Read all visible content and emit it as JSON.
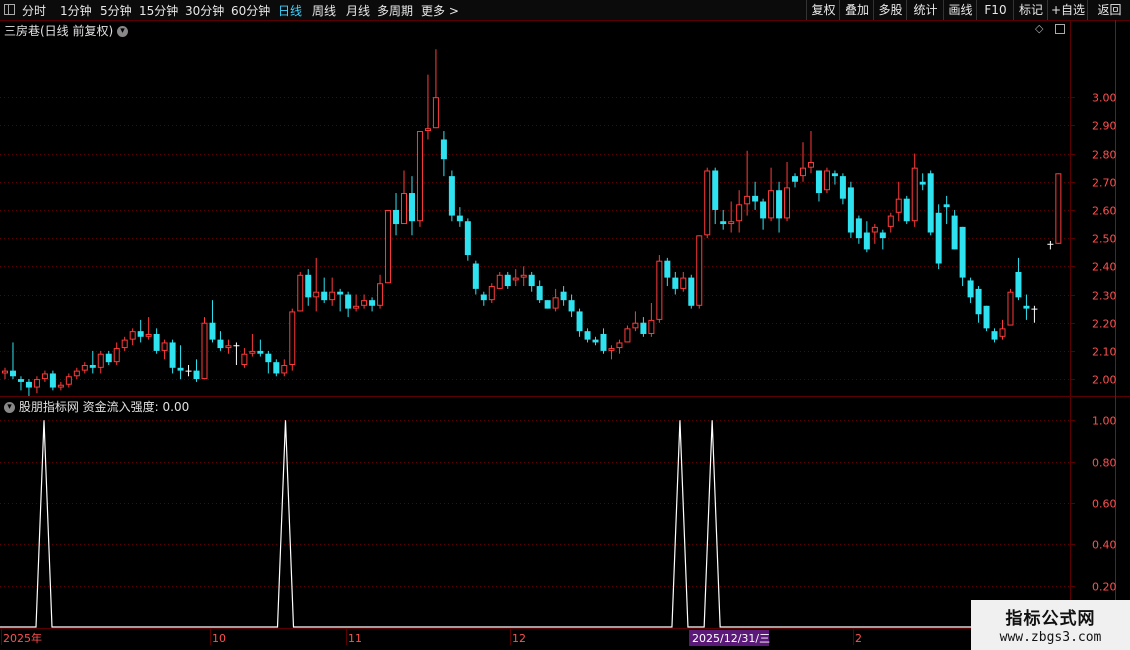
{
  "toolbar": {
    "periods": [
      "分时",
      "1分钟",
      "5分钟",
      "15分钟",
      "30分钟",
      "60分钟",
      "日线",
      "周线",
      "月线",
      "多周期",
      "更多 >"
    ],
    "active_period": "日线",
    "actions": [
      "复权",
      "叠加",
      "多股",
      "统计",
      "画线",
      "F10",
      "标记",
      "+自选",
      "返回"
    ]
  },
  "main_panel": {
    "title": "三房巷(日线 前复权)",
    "y_ticks": [
      "3.00",
      "2.90",
      "2.80",
      "2.70",
      "2.60",
      "2.50",
      "2.40",
      "2.30",
      "2.20",
      "2.10",
      "2.00"
    ]
  },
  "indicator_panel": {
    "title": "股朋指标网 资金流入强度: 0.00",
    "y_ticks": [
      "1.00",
      "0.80",
      "0.60",
      "0.40",
      "0.20"
    ]
  },
  "x_axis": {
    "labels": [
      "2025年",
      "10",
      "11",
      "12",
      "2025/12/31/三",
      "2"
    ]
  },
  "watermark": {
    "line1": "指标公式网",
    "line2": "www.zbgs3.com"
  },
  "colors": {
    "up": "#ff3b3b",
    "down": "#2fe2f0",
    "doji": "#ffffff",
    "grid": "#5a0000",
    "signal": "#ffffff"
  },
  "chart_data": [
    {
      "type": "candlestick",
      "title": "三房巷(日线 前复权)",
      "ylim": [
        1.94,
        3.21
      ],
      "grid": true,
      "candles": [
        [
          2.02,
          2.03,
          2.04,
          2.0
        ],
        [
          2.03,
          2.01,
          2.13,
          2.0
        ],
        [
          2.0,
          1.99,
          2.01,
          1.96
        ],
        [
          1.99,
          1.97,
          2.0,
          1.94
        ],
        [
          1.97,
          2.0,
          2.01,
          1.95
        ],
        [
          2.0,
          2.02,
          2.03,
          1.99
        ],
        [
          2.02,
          1.97,
          2.03,
          1.96
        ],
        [
          1.97,
          1.98,
          1.99,
          1.96
        ],
        [
          1.98,
          2.01,
          2.02,
          1.97
        ],
        [
          2.01,
          2.03,
          2.04,
          2.0
        ],
        [
          2.03,
          2.05,
          2.06,
          2.02
        ],
        [
          2.05,
          2.04,
          2.1,
          2.02
        ],
        [
          2.04,
          2.09,
          2.1,
          2.02
        ],
        [
          2.09,
          2.06,
          2.1,
          2.05
        ],
        [
          2.06,
          2.11,
          2.13,
          2.05
        ],
        [
          2.11,
          2.14,
          2.15,
          2.1
        ],
        [
          2.14,
          2.17,
          2.18,
          2.12
        ],
        [
          2.17,
          2.15,
          2.21,
          2.13
        ],
        [
          2.15,
          2.16,
          2.22,
          2.14
        ],
        [
          2.16,
          2.1,
          2.18,
          2.09
        ],
        [
          2.1,
          2.13,
          2.14,
          2.07
        ],
        [
          2.13,
          2.04,
          2.14,
          2.02
        ],
        [
          2.04,
          2.03,
          2.12,
          2.0
        ],
        [
          2.03,
          2.03,
          2.05,
          2.01
        ],
        [
          2.03,
          2.0,
          2.07,
          1.99
        ],
        [
          2.0,
          2.2,
          2.22,
          2.0
        ],
        [
          2.2,
          2.14,
          2.28,
          2.13
        ],
        [
          2.14,
          2.11,
          2.17,
          2.1
        ],
        [
          2.11,
          2.12,
          2.14,
          2.09
        ],
        [
          2.12,
          2.12,
          2.13,
          2.05
        ],
        [
          2.05,
          2.09,
          2.11,
          2.04
        ],
        [
          2.09,
          2.1,
          2.16,
          2.08
        ],
        [
          2.1,
          2.09,
          2.14,
          2.08
        ],
        [
          2.09,
          2.06,
          2.1,
          2.02
        ],
        [
          2.06,
          2.02,
          2.07,
          2.01
        ],
        [
          2.02,
          2.05,
          2.07,
          2.01
        ],
        [
          2.05,
          2.24,
          2.25,
          2.03
        ],
        [
          2.24,
          2.37,
          2.38,
          2.24
        ],
        [
          2.37,
          2.29,
          2.39,
          2.26
        ],
        [
          2.29,
          2.31,
          2.43,
          2.24
        ],
        [
          2.31,
          2.28,
          2.36,
          2.27
        ],
        [
          2.28,
          2.31,
          2.36,
          2.26
        ],
        [
          2.31,
          2.3,
          2.32,
          2.24
        ],
        [
          2.3,
          2.25,
          2.31,
          2.22
        ],
        [
          2.25,
          2.26,
          2.3,
          2.24
        ],
        [
          2.26,
          2.28,
          2.3,
          2.25
        ],
        [
          2.28,
          2.26,
          2.29,
          2.24
        ],
        [
          2.26,
          2.34,
          2.37,
          2.25
        ],
        [
          2.34,
          2.6,
          2.6,
          2.34
        ],
        [
          2.6,
          2.55,
          2.66,
          2.51
        ],
        [
          2.55,
          2.66,
          2.74,
          2.55
        ],
        [
          2.66,
          2.56,
          2.72,
          2.51
        ],
        [
          2.56,
          2.88,
          2.88,
          2.54
        ],
        [
          2.88,
          2.89,
          3.08,
          2.85
        ],
        [
          2.89,
          3.0,
          3.17,
          2.89
        ],
        [
          2.85,
          2.78,
          2.88,
          2.72
        ],
        [
          2.72,
          2.58,
          2.74,
          2.56
        ],
        [
          2.58,
          2.56,
          2.61,
          2.54
        ],
        [
          2.56,
          2.44,
          2.57,
          2.42
        ],
        [
          2.41,
          2.32,
          2.42,
          2.3
        ],
        [
          2.3,
          2.28,
          2.31,
          2.26
        ],
        [
          2.28,
          2.33,
          2.34,
          2.27
        ],
        [
          2.32,
          2.37,
          2.38,
          2.32
        ],
        [
          2.37,
          2.33,
          2.38,
          2.32
        ],
        [
          2.35,
          2.36,
          2.39,
          2.33
        ],
        [
          2.36,
          2.37,
          2.4,
          2.33
        ],
        [
          2.37,
          2.33,
          2.38,
          2.31
        ],
        [
          2.33,
          2.28,
          2.35,
          2.27
        ],
        [
          2.28,
          2.25,
          2.28,
          2.25
        ],
        [
          2.25,
          2.29,
          2.32,
          2.24
        ],
        [
          2.31,
          2.28,
          2.33,
          2.26
        ],
        [
          2.28,
          2.24,
          2.3,
          2.22
        ],
        [
          2.24,
          2.17,
          2.25,
          2.15
        ],
        [
          2.17,
          2.14,
          2.18,
          2.13
        ],
        [
          2.14,
          2.13,
          2.15,
          2.12
        ],
        [
          2.16,
          2.1,
          2.18,
          2.09
        ],
        [
          2.1,
          2.11,
          2.12,
          2.07
        ],
        [
          2.11,
          2.13,
          2.14,
          2.09
        ],
        [
          2.13,
          2.18,
          2.19,
          2.13
        ],
        [
          2.18,
          2.2,
          2.24,
          2.17
        ],
        [
          2.2,
          2.16,
          2.22,
          2.15
        ],
        [
          2.16,
          2.21,
          2.27,
          2.15
        ],
        [
          2.21,
          2.42,
          2.44,
          2.2
        ],
        [
          2.42,
          2.36,
          2.43,
          2.33
        ],
        [
          2.36,
          2.32,
          2.38,
          2.3
        ],
        [
          2.32,
          2.36,
          2.38,
          2.31
        ],
        [
          2.36,
          2.26,
          2.37,
          2.25
        ],
        [
          2.26,
          2.51,
          2.51,
          2.25
        ],
        [
          2.51,
          2.74,
          2.75,
          2.5
        ],
        [
          2.74,
          2.6,
          2.75,
          2.55
        ],
        [
          2.56,
          2.55,
          2.6,
          2.53
        ],
        [
          2.55,
          2.56,
          2.63,
          2.52
        ],
        [
          2.56,
          2.62,
          2.67,
          2.52
        ],
        [
          2.62,
          2.65,
          2.81,
          2.58
        ],
        [
          2.65,
          2.63,
          2.7,
          2.6
        ],
        [
          2.63,
          2.57,
          2.64,
          2.53
        ],
        [
          2.57,
          2.67,
          2.75,
          2.56
        ],
        [
          2.67,
          2.57,
          2.7,
          2.52
        ],
        [
          2.57,
          2.68,
          2.77,
          2.56
        ],
        [
          2.72,
          2.7,
          2.73,
          2.68
        ],
        [
          2.72,
          2.75,
          2.84,
          2.7
        ],
        [
          2.75,
          2.77,
          2.88,
          2.73
        ],
        [
          2.74,
          2.66,
          2.74,
          2.63
        ],
        [
          2.67,
          2.74,
          2.75,
          2.66
        ],
        [
          2.73,
          2.72,
          2.74,
          2.69
        ],
        [
          2.72,
          2.64,
          2.73,
          2.62
        ],
        [
          2.68,
          2.52,
          2.7,
          2.5
        ],
        [
          2.57,
          2.5,
          2.58,
          2.48
        ],
        [
          2.52,
          2.46,
          2.56,
          2.45
        ],
        [
          2.52,
          2.54,
          2.55,
          2.48
        ],
        [
          2.52,
          2.5,
          2.53,
          2.46
        ],
        [
          2.54,
          2.58,
          2.59,
          2.52
        ],
        [
          2.59,
          2.64,
          2.7,
          2.56
        ],
        [
          2.64,
          2.56,
          2.65,
          2.55
        ],
        [
          2.56,
          2.75,
          2.8,
          2.54
        ],
        [
          2.7,
          2.69,
          2.73,
          2.67
        ],
        [
          2.73,
          2.52,
          2.74,
          2.51
        ],
        [
          2.59,
          2.41,
          2.62,
          2.39
        ],
        [
          2.62,
          2.61,
          2.65,
          2.55
        ],
        [
          2.58,
          2.46,
          2.6,
          2.46
        ],
        [
          2.54,
          2.36,
          2.54,
          2.33
        ],
        [
          2.35,
          2.29,
          2.36,
          2.27
        ],
        [
          2.32,
          2.23,
          2.33,
          2.2
        ],
        [
          2.26,
          2.18,
          2.26,
          2.17
        ],
        [
          2.17,
          2.14,
          2.18,
          2.13
        ],
        [
          2.15,
          2.18,
          2.21,
          2.14
        ],
        [
          2.19,
          2.31,
          2.32,
          2.19
        ],
        [
          2.38,
          2.29,
          2.43,
          2.28
        ],
        [
          2.26,
          2.25,
          2.3,
          2.21
        ],
        [
          2.25,
          2.25,
          2.26,
          2.2
        ],
        null,
        [
          2.48,
          2.48,
          2.49,
          2.46
        ],
        [
          2.48,
          2.73,
          2.73,
          2.48
        ]
      ]
    },
    {
      "type": "line",
      "title": "股朋指标网 资金流入强度",
      "ylim": [
        0,
        1.05
      ],
      "series": [
        {
          "name": "资金流入强度",
          "spikes_at_bars": [
            5,
            35,
            84,
            88
          ],
          "spike_value": 1.0,
          "base_value": 0.0
        }
      ]
    }
  ]
}
